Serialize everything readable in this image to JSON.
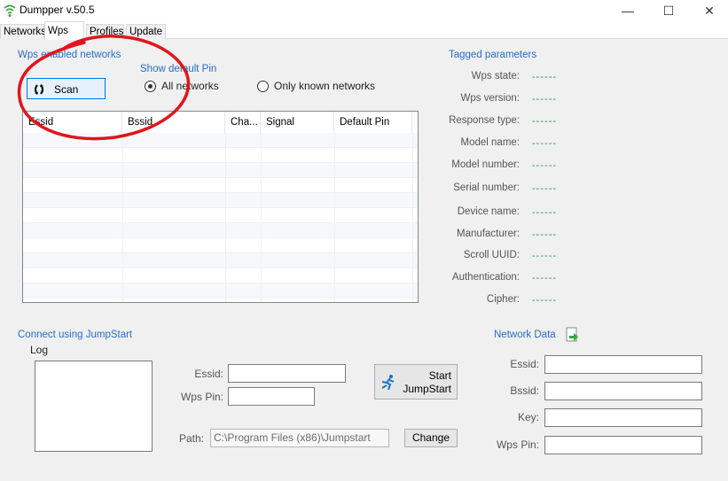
{
  "window": {
    "title": "Dumpper v.50.5",
    "min_glyph": "—",
    "max_glyph": "☐",
    "close_glyph": "✕",
    "accent": "#2a6cc4"
  },
  "tabs": [
    "Networks",
    "Wps",
    "Profiles",
    "Update"
  ],
  "wps_networks": {
    "heading": "Wps enabled networks",
    "scan_label": "Scan",
    "show_default_pin": "Show default Pin",
    "radio_all": "All networks",
    "radio_known": "Only known networks",
    "columns": [
      "Essid",
      "Bssid",
      "Cha...",
      "Signal",
      "Default Pin"
    ]
  },
  "tagged": {
    "heading": "Tagged parameters",
    "empty_value": "------",
    "params": [
      "Wps state:",
      "Wps version:",
      "Response type:",
      "Model name:",
      "Model number:",
      "Serial number:",
      "Device name:",
      "Manufacturer:",
      "Scroll UUID:",
      "Authentication:",
      "Cipher:"
    ]
  },
  "jumpstart": {
    "heading": "Connect using JumpStart",
    "log_label": "Log",
    "essid_label": "Essid:",
    "wps_pin_label": "Wps Pin:",
    "start_line1": "Start",
    "start_line2": "JumpStart",
    "path_label": "Path:",
    "path_value": "C:\\Program Files (x86)\\Jumpstart",
    "change_label": "Change"
  },
  "network_data": {
    "heading": "Network Data",
    "essid_label": "Essid:",
    "bssid_label": "Bssid:",
    "key_label": "Key:",
    "wps_pin_label": "Wps Pin:"
  },
  "annotation": {
    "color": "#e0161c"
  }
}
